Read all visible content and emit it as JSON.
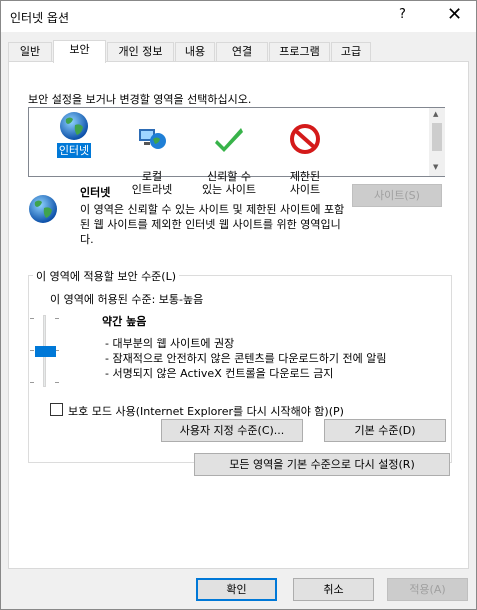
{
  "window": {
    "title": "인터넷 옵션",
    "help": "?",
    "close": "✕"
  },
  "tabs": [
    {
      "label": "일반"
    },
    {
      "label": "보안"
    },
    {
      "label": "개인 정보"
    },
    {
      "label": "내용"
    },
    {
      "label": "연결"
    },
    {
      "label": "프로그램"
    },
    {
      "label": "고급"
    }
  ],
  "security": {
    "instruction": "보안 설정을 보거나 변경할 영역을 선택하십시오.",
    "zones": [
      {
        "label": "인터넷",
        "icon": "globe-icon"
      },
      {
        "label": "로컬\n인트라넷",
        "icon": "intranet-icon"
      },
      {
        "label": "신뢰할 수\n있는 사이트",
        "icon": "checkmark-icon"
      },
      {
        "label": "제한된\n사이트",
        "icon": "restricted-icon"
      }
    ],
    "selected_zone_title": "인터넷",
    "selected_zone_desc": "이 영역은 신뢰할 수 있는 사이트 및 제한된 사이트에 포함된 웹 사이트를 제외한 인터넷 웹 사이트를 위한 영역입니다.",
    "sites_button": "사이트(S)",
    "level_group_label": "이 영역에 적용할 보안 수준(L)",
    "allowed_level": "이 영역에 허용된 수준: 보통-높음",
    "level_name": "약간 높음",
    "level_bullets": [
      "- 대부분의 웹 사이트에 권장",
      "- 잠재적으로 안전하지 않은 콘텐츠를 다운로드하기 전에 알림",
      "- 서명되지 않은 ActiveX 컨트롤을 다운로드 금지"
    ],
    "protected_mode": "보호 모드 사용(Internet Explorer를 다시 시작해야 함)(P)",
    "custom_level_button": "사용자 지정 수준(C)...",
    "default_level_button": "기본 수준(D)",
    "reset_all_button": "모든 영역을 기본 수준으로 다시 설정(R)"
  },
  "footer": {
    "ok": "확인",
    "cancel": "취소",
    "apply": "적용(A)"
  },
  "colors": {
    "accent": "#0078d7"
  }
}
